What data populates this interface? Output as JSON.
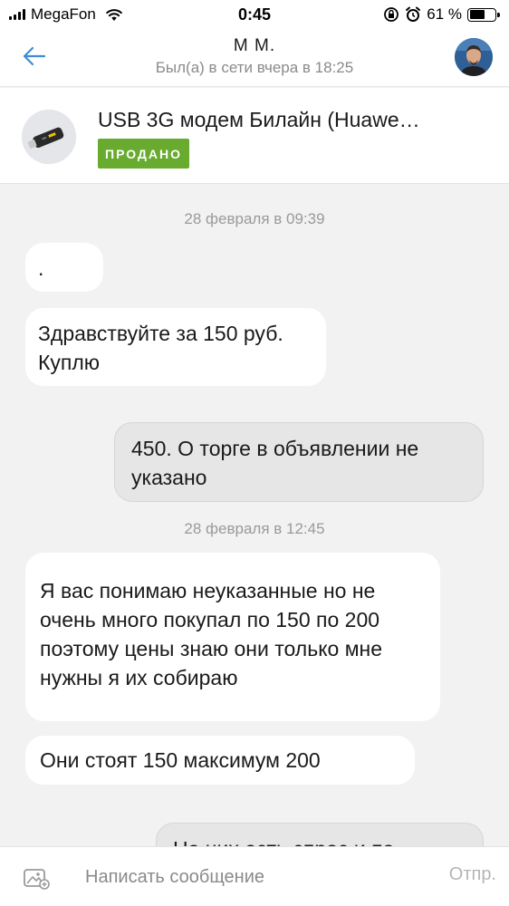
{
  "status_bar": {
    "carrier": "MegaFon",
    "time": "0:45",
    "battery": "61 %",
    "battery_level": 0.61
  },
  "header": {
    "contact_name": "М М.",
    "contact_status": "Был(а) в сети вчера в 18:25"
  },
  "listing": {
    "title": "USB 3G модем Билайн (Huawe…",
    "badge": "ПРОДАНО"
  },
  "chat": {
    "dates": [
      "28 февраля в 09:39",
      "28 февраля в 12:45"
    ],
    "messages": [
      {
        "direction": "in",
        "text": "."
      },
      {
        "direction": "in",
        "text": "Здравствуйте за 150 руб. Куплю"
      },
      {
        "direction": "out",
        "text": "450. О торге в объявлении не указано"
      },
      {
        "direction": "in",
        "text": "Я вас понимаю неуказанные но не очень много покупал по 150 по 200 поэтому цены знаю они только мне нужны я их собираю"
      },
      {
        "direction": "in",
        "text": "Они стоят 150 максимум 200"
      },
      {
        "direction": "out",
        "text": "На них есть спрос и по"
      }
    ]
  },
  "composer": {
    "placeholder": "Написать сообщение",
    "send_label": "Отпр."
  },
  "colors": {
    "accent_blue": "#3d8bd9",
    "sold_green": "#68ab2f",
    "chat_background": "#f2f2f2",
    "outgoing_bubble": "#e6e6e6",
    "incoming_bubble": "#ffffff"
  }
}
